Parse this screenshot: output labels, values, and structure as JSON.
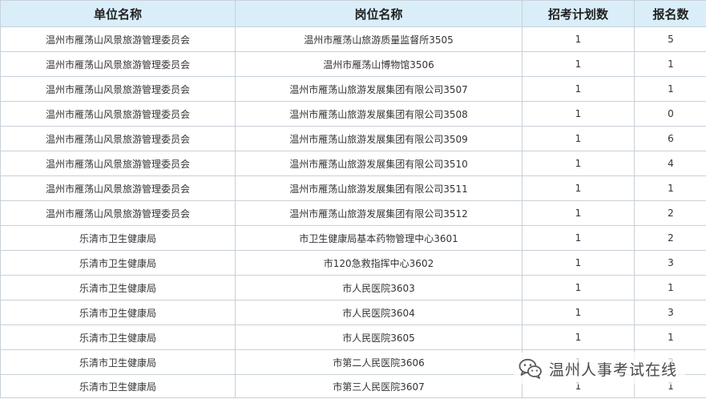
{
  "table": {
    "headers": [
      "单位名称",
      "岗位名称",
      "招考计划数",
      "报名数"
    ],
    "rows": [
      [
        "温州市雁荡山风景旅游管理委员会",
        "温州市雁荡山旅游质量监督所3505",
        "1",
        "5"
      ],
      [
        "温州市雁荡山风景旅游管理委员会",
        "温州市雁荡山博物馆3506",
        "1",
        "1"
      ],
      [
        "温州市雁荡山风景旅游管理委员会",
        "温州市雁荡山旅游发展集团有限公司3507",
        "1",
        "1"
      ],
      [
        "温州市雁荡山风景旅游管理委员会",
        "温州市雁荡山旅游发展集团有限公司3508",
        "1",
        "0"
      ],
      [
        "温州市雁荡山风景旅游管理委员会",
        "温州市雁荡山旅游发展集团有限公司3509",
        "1",
        "6"
      ],
      [
        "温州市雁荡山风景旅游管理委员会",
        "温州市雁荡山旅游发展集团有限公司3510",
        "1",
        "4"
      ],
      [
        "温州市雁荡山风景旅游管理委员会",
        "温州市雁荡山旅游发展集团有限公司3511",
        "1",
        "1"
      ],
      [
        "温州市雁荡山风景旅游管理委员会",
        "温州市雁荡山旅游发展集团有限公司3512",
        "1",
        "2"
      ],
      [
        "乐清市卫生健康局",
        "市卫生健康局基本药物管理中心3601",
        "1",
        "2"
      ],
      [
        "乐清市卫生健康局",
        "市120急救指挥中心3602",
        "1",
        "3"
      ],
      [
        "乐清市卫生健康局",
        "市人民医院3603",
        "1",
        "1"
      ],
      [
        "乐清市卫生健康局",
        "市人民医院3604",
        "1",
        "3"
      ],
      [
        "乐清市卫生健康局",
        "市人民医院3605",
        "1",
        "1"
      ],
      [
        "乐清市卫生健康局",
        "市第二人民医院3606",
        "1",
        "2"
      ],
      [
        "乐清市卫生健康局",
        "市第三人民医院3607",
        "1",
        "1"
      ]
    ]
  },
  "watermark": {
    "icon": "wechat-icon",
    "text": "温州人事考试在线"
  },
  "colors": {
    "header_bg": "#d9eef8",
    "border": "#c8d0d8",
    "text": "#333333"
  }
}
